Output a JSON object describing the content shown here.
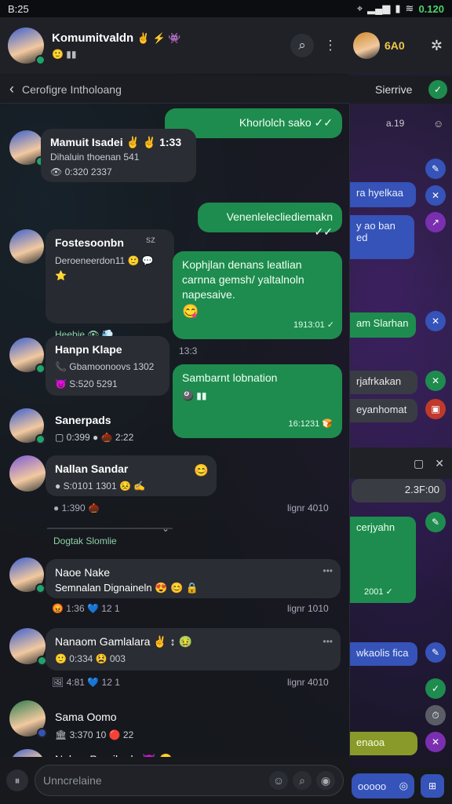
{
  "status_bar": {
    "time": "B:25",
    "battery": "0.120"
  },
  "header": {
    "title": "Komumitvaldn",
    "title_emoji": "✌ ⚡ 👾",
    "subtitle": "🙂 ▮▮",
    "search_icon": "search-icon",
    "more_icon": "more-vertical-icon"
  },
  "subheader": {
    "back_icon": "back-arrow-icon",
    "label": "Cerofigre Intholoang"
  },
  "messages": [
    {
      "type": "out",
      "text": "Khorlolch sako ✓✓"
    },
    {
      "type": "in",
      "name": "Mamuit Isadei ✌ ✌ 1:33",
      "line1": "Dihaluin thoenan 541",
      "line2": "👁 0:320 2337"
    },
    {
      "type": "out",
      "text": "Venenlelecliediemakn ✓✓"
    },
    {
      "type": "in",
      "name": "Fostesoonbn",
      "extra": "sz",
      "line1": "Deroeneerdon11 🙂 💬 ⭐",
      "line2": "Heebie 👁 💨"
    },
    {
      "type": "out",
      "text": "Kophjlan denans leatlian carnna gemsh/ yaltalnoln napesaive.",
      "emoji": "😋",
      "time": "1913:01 ✓"
    },
    {
      "type": "in",
      "name": "Hanpn Klape",
      "time": "13:3",
      "line1": "📞 Gbamoonoovs 1302",
      "line2": "😈 S:520 5291"
    },
    {
      "type": "out",
      "text": "Sambarnt lobnation",
      "sub": "🎱 ▮▮",
      "time": "16:1231 🍞"
    },
    {
      "type": "in",
      "name": "Sanerpads",
      "line1": "▢ 0:399 ● 🌰 2:22"
    },
    {
      "type": "in",
      "name": "Nallan Sandar",
      "emoji": "😊",
      "line1": "● S:0101 1301 😣 ✍"
    },
    {
      "type": "meta",
      "left": "● 1:390 🌰",
      "right": "lignr 4010"
    },
    {
      "type": "section",
      "label": "Dogtak Slomlie"
    },
    {
      "type": "in",
      "name": "Naoe Nake",
      "line1": "Semnalan Dignaineln 😍 😊 🔒",
      "dots": "•••"
    },
    {
      "type": "meta",
      "left": "😡 1:36 💙 12 1",
      "right": "lignr 1010"
    },
    {
      "type": "in",
      "name": "Nanaom Gamlalara ✌ ↕ 🤢",
      "line1": "🙂 0:334 😫 003",
      "dots": "•••"
    },
    {
      "type": "meta",
      "left": "🖼 4:81 💙 12 1",
      "right": "lignr 4010"
    },
    {
      "type": "in",
      "name": "Sama Oomo",
      "line1": "🏛 3:370 10 🔴 22"
    },
    {
      "type": "in",
      "name": "Nakan Pornikarle 😈 😊",
      "dots": "••"
    }
  ],
  "composer": {
    "placeholder": "Unncrelaine",
    "icons": [
      "attach-icon",
      "emoji-icon",
      "search-icon",
      "gif-icon"
    ]
  },
  "right_panel": {
    "header_label": "Sierrive",
    "count": "6A0",
    "bubbles": [
      {
        "text": "Sierrive",
        "kind": "header"
      },
      {
        "text": "a.19",
        "kind": "time"
      },
      {
        "text": "ra hyelkaa",
        "kind": "blue"
      },
      {
        "text": "y ao ban\ned",
        "kind": "blue"
      },
      {
        "text": "am Slarhan",
        "kind": "green"
      },
      {
        "text": "rjafrkakan",
        "kind": "gray"
      },
      {
        "text": "eyanhomat",
        "kind": "gray"
      },
      {
        "text": "2.3F:00",
        "kind": "gray"
      },
      {
        "text": "cerjyahn",
        "kind": "green"
      },
      {
        "text": "2001 ✓",
        "kind": "green-time"
      },
      {
        "text": "wkaolis fica",
        "kind": "blue"
      },
      {
        "text": "enaoa",
        "kind": "yellowg"
      },
      {
        "text": "ooooo",
        "kind": "blue"
      }
    ]
  },
  "colors": {
    "accent_green": "#1e8c4e",
    "accent_blue": "#3553b8",
    "panel": "#1f2127"
  }
}
